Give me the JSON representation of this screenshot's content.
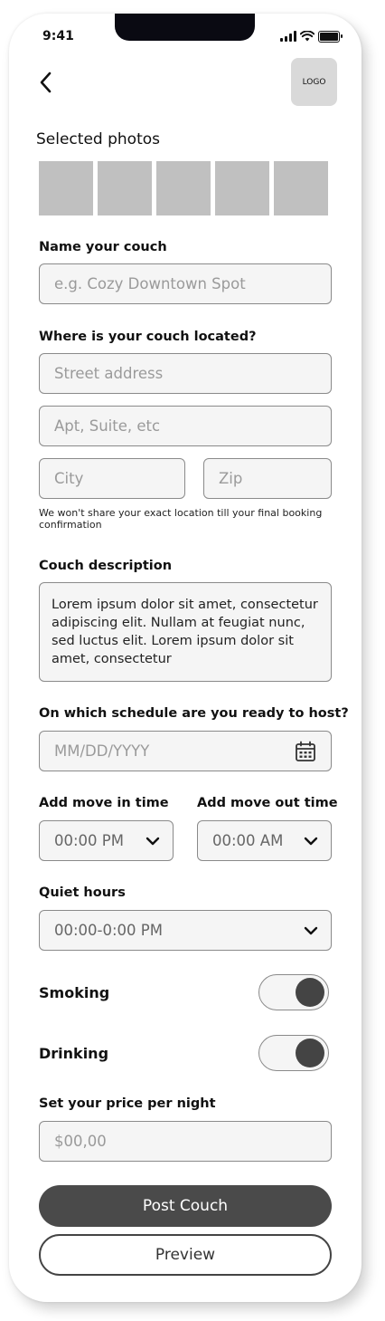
{
  "status_bar": {
    "time": "9:41"
  },
  "header": {
    "logo_text": "LOGO"
  },
  "photos": {
    "title": "Selected photos",
    "count": 5
  },
  "name": {
    "label": "Name your couch",
    "placeholder": "e.g. Cozy Downtown Spot"
  },
  "location": {
    "label": "Where is your couch located?",
    "street_placeholder": "Street address",
    "apt_placeholder": "Apt, Suite, etc",
    "city_placeholder": "City",
    "zip_placeholder": "Zip",
    "note": "We won't share your exact location till your final booking confirmation"
  },
  "description": {
    "label": "Couch description",
    "value": "Lorem ipsum dolor sit amet, consectetur adipiscing elit. Nullam at feugiat nunc, sed luctus elit. Lorem ipsum dolor sit amet, consectetur"
  },
  "schedule": {
    "label": "On which schedule are you ready to host?",
    "placeholder": "MM/DD/YYYY",
    "icon": "calendar-icon"
  },
  "move_in": {
    "label": "Add move in time",
    "value": "00:00 PM"
  },
  "move_out": {
    "label": "Add move out time",
    "value": "00:00 AM"
  },
  "quiet_hours": {
    "label": "Quiet hours",
    "value": "00:00-0:00 PM"
  },
  "smoking": {
    "label": "Smoking",
    "on": true
  },
  "drinking": {
    "label": "Drinking",
    "on": true
  },
  "price": {
    "label": "Set your price per night",
    "placeholder": "$00,00"
  },
  "actions": {
    "post": "Post Couch",
    "preview": "Preview"
  },
  "colors": {
    "primary_button": "#4a4a4a",
    "input_bg": "#f5f5f5",
    "photo_placeholder": "#c0c0c0"
  }
}
